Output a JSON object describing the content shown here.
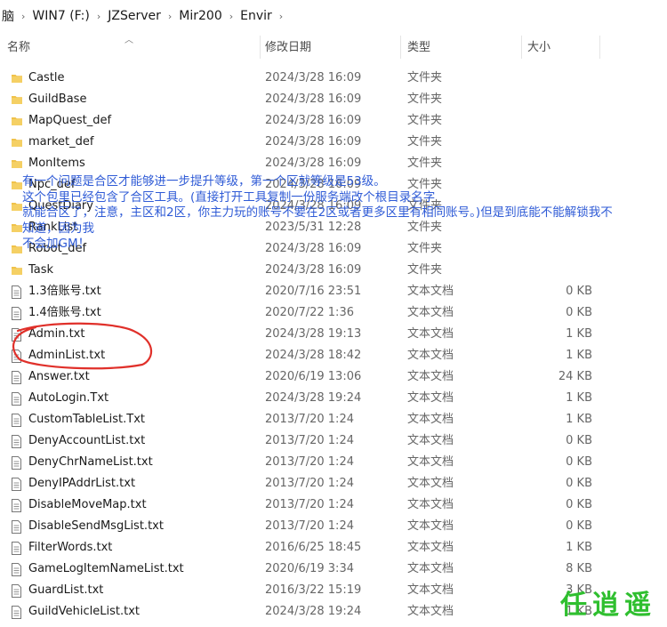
{
  "breadcrumb": [
    "脑",
    "WIN7 (F:)",
    "JZServer",
    "Mir200",
    "Envir"
  ],
  "columns": {
    "name": "名称",
    "modified": "修改日期",
    "type": "类型",
    "size": "大小"
  },
  "files": [
    {
      "name": "Castle",
      "date": "2024/3/28 16:09",
      "type": "文件夹",
      "size": "",
      "kind": "folder"
    },
    {
      "name": "GuildBase",
      "date": "2024/3/28 16:09",
      "type": "文件夹",
      "size": "",
      "kind": "folder"
    },
    {
      "name": "MapQuest_def",
      "date": "2024/3/28 16:09",
      "type": "文件夹",
      "size": "",
      "kind": "folder"
    },
    {
      "name": "market_def",
      "date": "2024/3/28 16:09",
      "type": "文件夹",
      "size": "",
      "kind": "folder"
    },
    {
      "name": "MonItems",
      "date": "2024/3/28 16:09",
      "type": "文件夹",
      "size": "",
      "kind": "folder"
    },
    {
      "name": "Npc_def",
      "date": "2024/3/28 16:09",
      "type": "文件夹",
      "size": "",
      "kind": "folder"
    },
    {
      "name": "QuestDiary",
      "date": "2024/3/28 16:09",
      "type": "文件夹",
      "size": "",
      "kind": "folder"
    },
    {
      "name": "RankList",
      "date": "2023/5/31 12:28",
      "type": "文件夹",
      "size": "",
      "kind": "folder"
    },
    {
      "name": "Robot_def",
      "date": "2024/3/28 16:09",
      "type": "文件夹",
      "size": "",
      "kind": "folder"
    },
    {
      "name": "Task",
      "date": "2024/3/28 16:09",
      "type": "文件夹",
      "size": "",
      "kind": "folder"
    },
    {
      "name": "1.3倍账号.txt",
      "date": "2020/7/16 23:51",
      "type": "文本文档",
      "size": "0 KB",
      "kind": "file"
    },
    {
      "name": "1.4倍账号.txt",
      "date": "2020/7/22 1:36",
      "type": "文本文档",
      "size": "0 KB",
      "kind": "file"
    },
    {
      "name": "Admin.txt",
      "date": "2024/3/28 19:13",
      "type": "文本文档",
      "size": "1 KB",
      "kind": "file"
    },
    {
      "name": "AdminList.txt",
      "date": "2024/3/28 18:42",
      "type": "文本文档",
      "size": "1 KB",
      "kind": "file"
    },
    {
      "name": "Answer.txt",
      "date": "2020/6/19 13:06",
      "type": "文本文档",
      "size": "24 KB",
      "kind": "file"
    },
    {
      "name": "AutoLogin.Txt",
      "date": "2024/3/28 19:24",
      "type": "文本文档",
      "size": "1 KB",
      "kind": "file"
    },
    {
      "name": "CustomTableList.Txt",
      "date": "2013/7/20 1:24",
      "type": "文本文档",
      "size": "1 KB",
      "kind": "file"
    },
    {
      "name": "DenyAccountList.txt",
      "date": "2013/7/20 1:24",
      "type": "文本文档",
      "size": "0 KB",
      "kind": "file"
    },
    {
      "name": "DenyChrNameList.txt",
      "date": "2013/7/20 1:24",
      "type": "文本文档",
      "size": "0 KB",
      "kind": "file"
    },
    {
      "name": "DenyIPAddrList.txt",
      "date": "2013/7/20 1:24",
      "type": "文本文档",
      "size": "0 KB",
      "kind": "file"
    },
    {
      "name": "DisableMoveMap.txt",
      "date": "2013/7/20 1:24",
      "type": "文本文档",
      "size": "0 KB",
      "kind": "file"
    },
    {
      "name": "DisableSendMsgList.txt",
      "date": "2013/7/20 1:24",
      "type": "文本文档",
      "size": "0 KB",
      "kind": "file"
    },
    {
      "name": "FilterWords.txt",
      "date": "2016/6/25 18:45",
      "type": "文本文档",
      "size": "1 KB",
      "kind": "file"
    },
    {
      "name": "GameLogItemNameList.txt",
      "date": "2020/6/19 3:34",
      "type": "文本文档",
      "size": "8 KB",
      "kind": "file"
    },
    {
      "name": "GuardList.txt",
      "date": "2016/3/22 15:19",
      "type": "文本文档",
      "size": "3 KB",
      "kind": "file"
    },
    {
      "name": "GuildVehicleList.txt",
      "date": "2024/3/28 19:24",
      "type": "文本文档",
      "size": "1 KB",
      "kind": "file"
    }
  ],
  "annotation": [
    "有一个问题是合区才能够进一步提升等级，第一个区就等级是53级。",
    "这个包里已经包含了合区工具。(直接打开工具复制一份服务端改个根目录名字",
    "就能合区了，注意，主区和2区，你主力玩的账号不要在2区或者更多区里有相同账号。)但是到底能不能解锁我不",
    "知道，因为我",
    "不会加GM！"
  ],
  "watermark": "任逍遥",
  "colors": {
    "folder": "#f0c24a",
    "annotation": "#2f5bd6",
    "circle": "#e0302a",
    "watermark": "#2fbf2f"
  }
}
